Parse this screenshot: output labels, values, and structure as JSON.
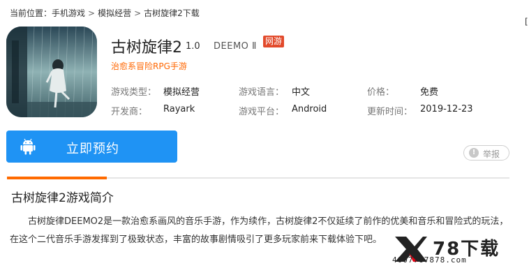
{
  "breadcrumb": {
    "prefix": "当前位置：",
    "items": [
      "手机游戏",
      "模拟经营",
      "古树旋律2下载"
    ],
    "separator": ">"
  },
  "side_glyph": "[",
  "app": {
    "name": "古树旋律2",
    "version": "1.0",
    "alias": "DEEMO Ⅱ",
    "badge": "网游",
    "tagline": "治愈系冒险RPG手游",
    "info": {
      "type_label": "游戏类型：",
      "type_value": "模拟经营",
      "lang_label": "游戏语言：",
      "lang_value": "中文",
      "price_label": "价格：",
      "price_value": "免费",
      "dev_label": "开发商：",
      "dev_value": "Rayark",
      "platform_label": "游戏平台：",
      "platform_value": "Android",
      "update_label": "更新时间：",
      "update_value": "2019-12-23"
    }
  },
  "actions": {
    "reserve_label": "立即预约",
    "report_label": "举报"
  },
  "section": {
    "title": "古树旋律2游戏简介",
    "description": "古树旋律DEEMO2是一款治愈系画风的音乐手游，作为续作，古树旋律2不仅延续了前作的优美和音乐和冒险式的玩法，在这个二代音乐手游发挥到了极致状态，丰富的故事剧情吸引了更多玩家前来下载体验下吧。"
  },
  "watermark": {
    "brand": "78下载",
    "phone": "4007787878.com"
  },
  "colors": {
    "accent": "#ff6a00",
    "button_blue": "#1f93f4",
    "badge_red": "#e24a2b",
    "tagline_orange": "#ff6600"
  }
}
